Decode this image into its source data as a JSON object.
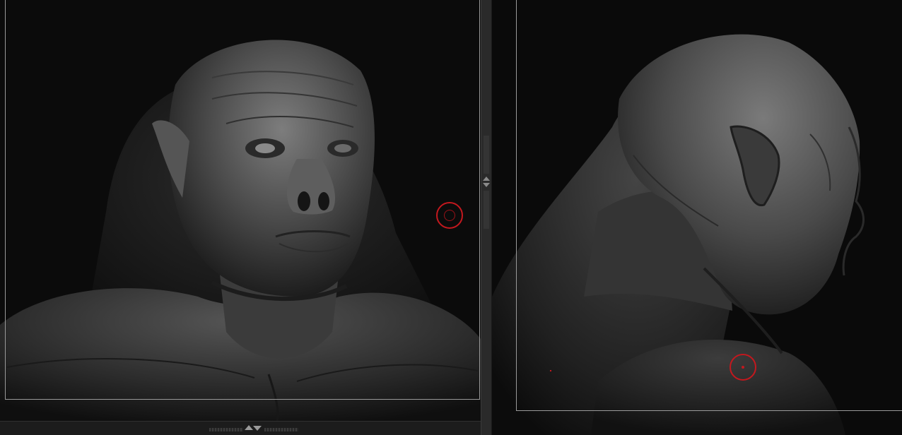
{
  "app": {
    "type": "3d-sculpting-viewports",
    "layout": "split-view"
  },
  "viewports": [
    {
      "id": "left",
      "view": "front-three-quarter",
      "subject": "orc-bust-sculpt"
    },
    {
      "id": "right",
      "view": "side-profile",
      "subject": "orc-bust-sculpt"
    }
  ],
  "brush_cursors": [
    {
      "viewport": "left",
      "style": "ring-with-inner-ring"
    },
    {
      "viewport": "right",
      "style": "ring-with-center-dot"
    }
  ],
  "colors": {
    "canvas_bg": "#0b0b0b",
    "panel_bg": "#2a2a2a",
    "cursor_red": "#c3181e",
    "frame_line": "#9a9a9a",
    "clay": "#6c6c6c"
  },
  "icons": [
    "divider-grip-icon",
    "collapse-arrows-icon",
    "panel-resize-grip-icon"
  ]
}
